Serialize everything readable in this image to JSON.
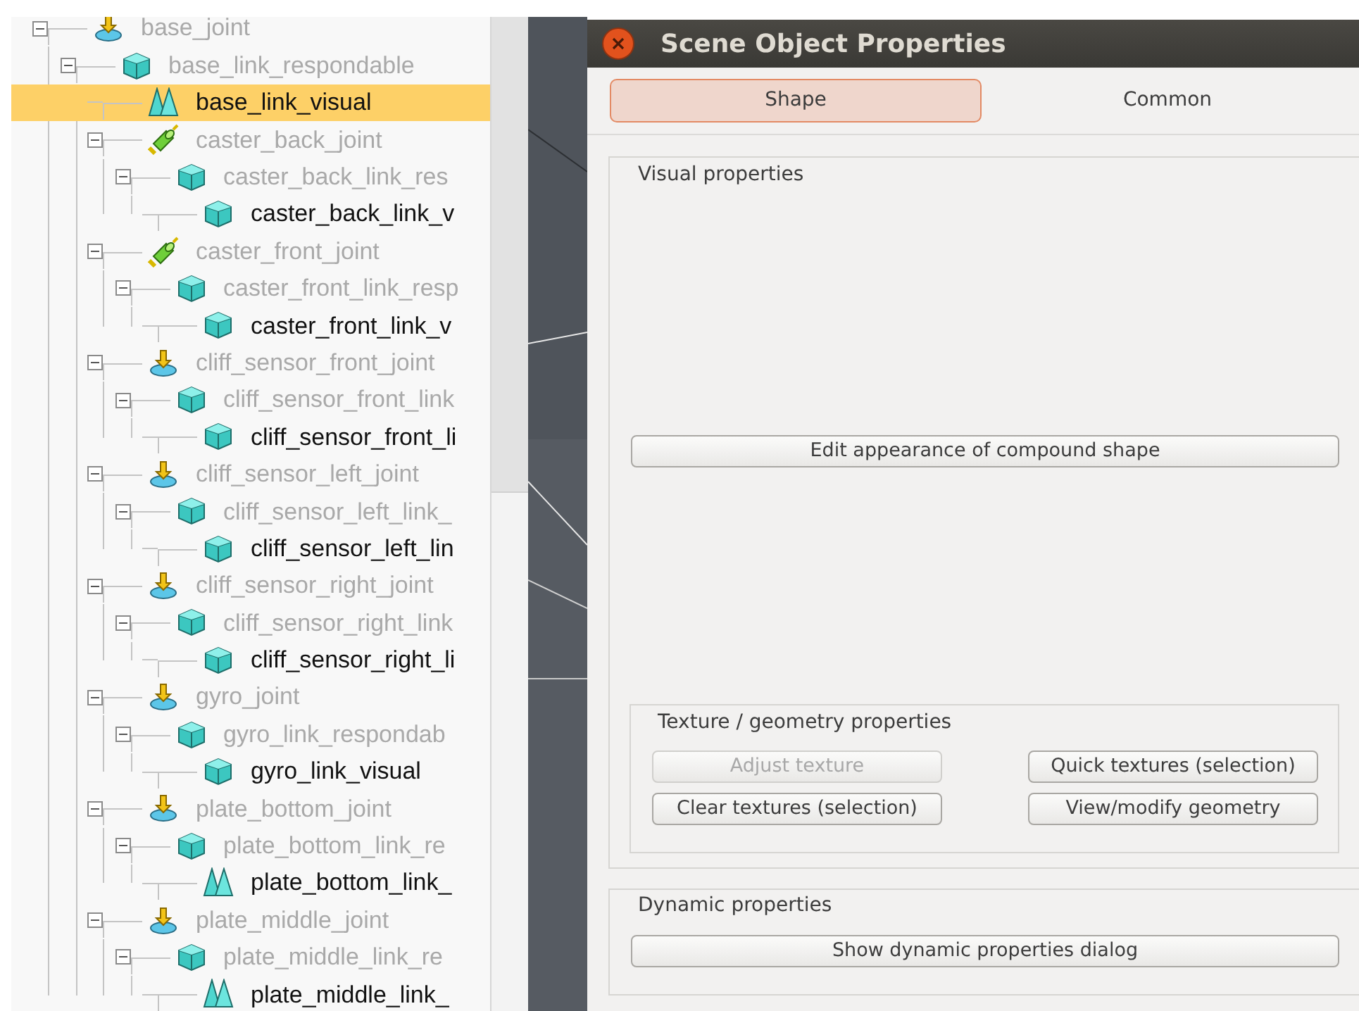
{
  "tree": [
    {
      "label": "base_joint",
      "kind": "arrow",
      "greyed": true,
      "selected": false,
      "expanded": true,
      "children": [
        {
          "label": "base_link_respondable",
          "kind": "cube",
          "greyed": true,
          "selected": false,
          "expanded": true,
          "children": [
            {
              "label": "base_link_visual",
              "kind": "cones",
              "greyed": false,
              "selected": true
            },
            {
              "label": "caster_back_joint",
              "kind": "cylinder",
              "greyed": true,
              "selected": false,
              "expanded": true,
              "children": [
                {
                  "label": "caster_back_link_res",
                  "kind": "cube",
                  "greyed": true,
                  "selected": false,
                  "expanded": true,
                  "children": [
                    {
                      "label": "caster_back_link_v",
                      "kind": "cube",
                      "greyed": false,
                      "selected": false
                    }
                  ]
                }
              ]
            },
            {
              "label": "caster_front_joint",
              "kind": "cylinder",
              "greyed": true,
              "selected": false,
              "expanded": true,
              "children": [
                {
                  "label": "caster_front_link_resp",
                  "kind": "cube",
                  "greyed": true,
                  "selected": false,
                  "expanded": true,
                  "children": [
                    {
                      "label": "caster_front_link_v",
                      "kind": "cube",
                      "greyed": false,
                      "selected": false
                    }
                  ]
                }
              ]
            },
            {
              "label": "cliff_sensor_front_joint",
              "kind": "arrow",
              "greyed": true,
              "selected": false,
              "expanded": true,
              "children": [
                {
                  "label": "cliff_sensor_front_link",
                  "kind": "cube",
                  "greyed": true,
                  "selected": false,
                  "expanded": true,
                  "children": [
                    {
                      "label": "cliff_sensor_front_li",
                      "kind": "cube",
                      "greyed": false,
                      "selected": false
                    }
                  ]
                }
              ]
            },
            {
              "label": "cliff_sensor_left_joint",
              "kind": "arrow",
              "greyed": true,
              "selected": false,
              "expanded": true,
              "children": [
                {
                  "label": "cliff_sensor_left_link_",
                  "kind": "cube",
                  "greyed": true,
                  "selected": false,
                  "expanded": true,
                  "children": [
                    {
                      "label": "cliff_sensor_left_lin",
                      "kind": "cube",
                      "greyed": false,
                      "selected": false
                    }
                  ]
                }
              ]
            },
            {
              "label": "cliff_sensor_right_joint",
              "kind": "arrow",
              "greyed": true,
              "selected": false,
              "expanded": true,
              "children": [
                {
                  "label": "cliff_sensor_right_link",
                  "kind": "cube",
                  "greyed": true,
                  "selected": false,
                  "expanded": true,
                  "children": [
                    {
                      "label": "cliff_sensor_right_li",
                      "kind": "cube",
                      "greyed": false,
                      "selected": false
                    }
                  ]
                }
              ]
            },
            {
              "label": "gyro_joint",
              "kind": "arrow",
              "greyed": true,
              "selected": false,
              "expanded": true,
              "children": [
                {
                  "label": "gyro_link_respondab",
                  "kind": "cube",
                  "greyed": true,
                  "selected": false,
                  "expanded": true,
                  "children": [
                    {
                      "label": "gyro_link_visual",
                      "kind": "cube",
                      "greyed": false,
                      "selected": false
                    }
                  ]
                }
              ]
            },
            {
              "label": "plate_bottom_joint",
              "kind": "arrow",
              "greyed": true,
              "selected": false,
              "expanded": true,
              "children": [
                {
                  "label": "plate_bottom_link_re",
                  "kind": "cube",
                  "greyed": true,
                  "selected": false,
                  "expanded": true,
                  "children": [
                    {
                      "label": "plate_bottom_link_",
                      "kind": "cones",
                      "greyed": false,
                      "selected": false
                    }
                  ]
                }
              ]
            },
            {
              "label": "plate_middle_joint",
              "kind": "arrow",
              "greyed": true,
              "selected": false,
              "expanded": true,
              "children": [
                {
                  "label": "plate_middle_link_re",
                  "kind": "cube",
                  "greyed": true,
                  "selected": false,
                  "expanded": true,
                  "children": [
                    {
                      "label": "plate_middle_link_",
                      "kind": "cones",
                      "greyed": false,
                      "selected": false
                    }
                  ]
                }
              ]
            }
          ]
        }
      ]
    }
  ],
  "dialog": {
    "title": "Scene Object Properties",
    "tabs": [
      {
        "label": "Shape",
        "selected": true
      },
      {
        "label": "Common",
        "selected": false
      }
    ],
    "visual": {
      "title": "Visual properties",
      "button": {
        "label": "Edit appearance of compound shape",
        "disabled": false
      },
      "texture": {
        "title": "Texture / geometry properties",
        "buttons": [
          {
            "label": "Adjust texture",
            "disabled": true
          },
          {
            "label": "Quick textures (selection)",
            "disabled": false
          },
          {
            "label": "Clear textures (selection)",
            "disabled": false
          },
          {
            "label": "View/modify geometry",
            "disabled": false
          }
        ]
      }
    },
    "dynamic": {
      "title": "Dynamic properties",
      "button": {
        "label": "Show dynamic properties dialog",
        "disabled": false
      }
    }
  }
}
